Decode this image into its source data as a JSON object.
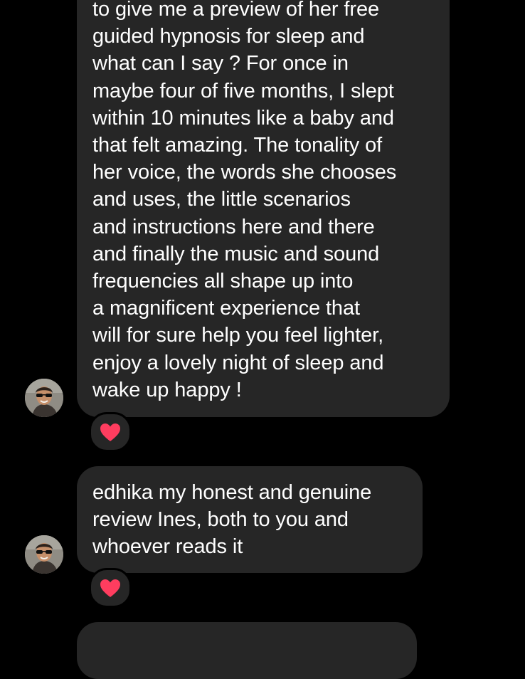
{
  "messages": [
    {
      "lines": [
        "to give me a preview of her free",
        "guided hypnosis for sleep and",
        "what can I say ? For once in",
        "maybe four of five months, I slept",
        "within 10 minutes like a baby and",
        "that felt amazing. The tonality of",
        "her voice, the words she chooses",
        "and uses, the little scenarios",
        "and instructions here and there",
        "and finally the music and sound",
        "frequencies all shape up into",
        "a magnificent experience that",
        "will for sure help you feel lighter,",
        "enjoy a lovely night of sleep and",
        "wake up happy !"
      ],
      "reaction": "heart-icon"
    },
    {
      "lines": [
        "edhika my honest and genuine",
        "review Ines, both to you and",
        "whoever reads it"
      ],
      "reaction": "heart-icon"
    },
    {
      "lines": []
    }
  ],
  "colors": {
    "background": "#000000",
    "bubble": "#262626",
    "text": "#ffffff",
    "heart": "#ff3d5f"
  }
}
